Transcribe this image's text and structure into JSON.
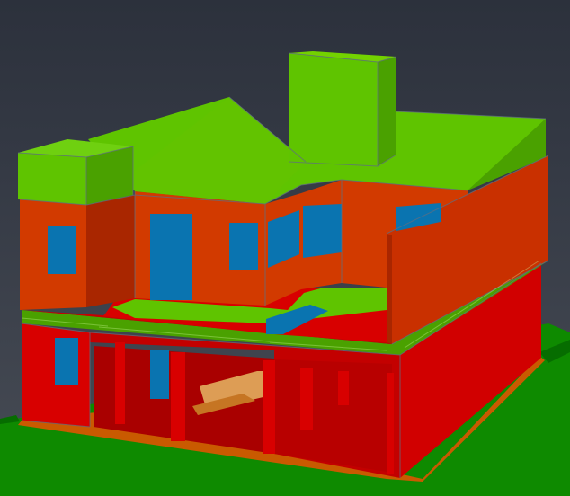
{
  "viewport": {
    "background_top": "#2c313c",
    "background_bottom": "#474c55"
  },
  "model": {
    "colors": {
      "roof_green": "#5fc400",
      "roof_green_dark": "#4aa100",
      "upper_wall_orange": "#d23a00",
      "upper_wall_shadow": "#a92600",
      "lower_wall_red": "#d80000",
      "lower_wall_shadow": "#aa0000",
      "window_blue": "#0a74b0",
      "floor_orange": "#c95a00",
      "floor_orange_light": "#db7000",
      "ground_green": "#0e8a00",
      "ground_green_dark": "#066d00",
      "edge_line": "#5f6e81"
    }
  }
}
